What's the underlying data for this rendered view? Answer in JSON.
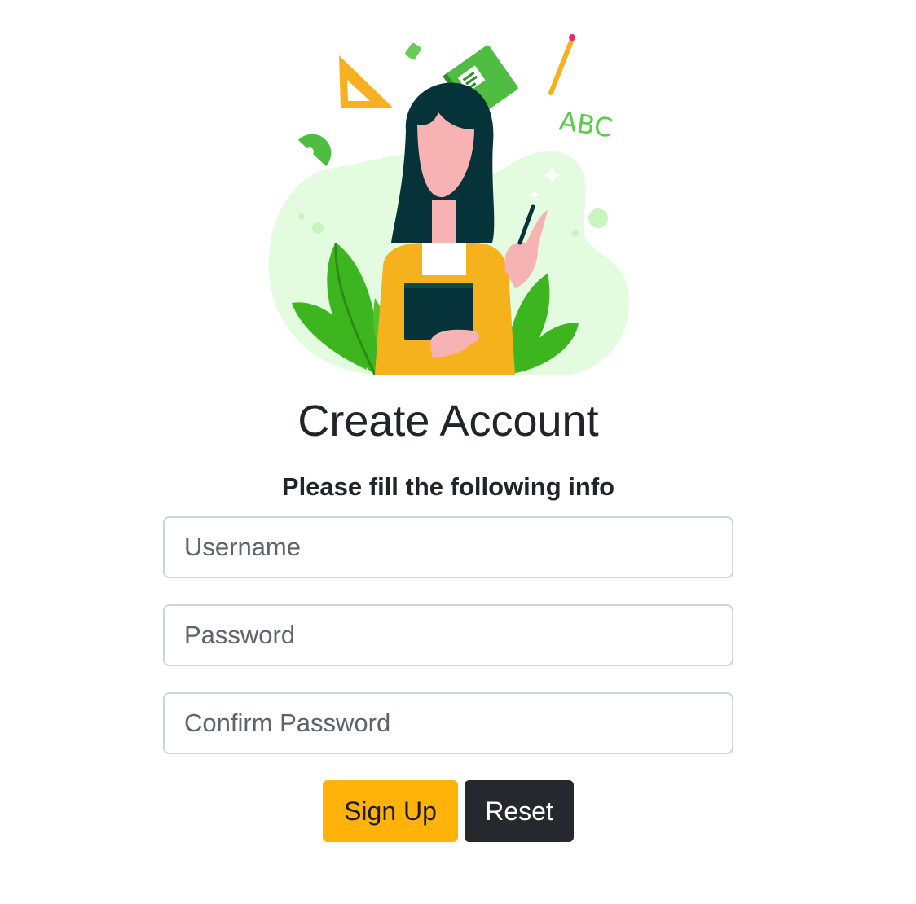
{
  "form": {
    "title": "Create Account",
    "subtitle": "Please fill the following info",
    "username": {
      "placeholder": "Username",
      "value": ""
    },
    "password": {
      "placeholder": "Password",
      "value": ""
    },
    "confirm_password": {
      "placeholder": "Confirm Password",
      "value": ""
    },
    "signup_label": "Sign Up",
    "reset_label": "Reset"
  },
  "illustration": {
    "name": "teacher-illustration",
    "abc_text": "ABC"
  },
  "colors": {
    "accent": "#ffb20a",
    "dark_button": "#25292d",
    "leaf_green": "#3db51f",
    "soft_green": "#e3fbdf",
    "hair": "#06323a"
  }
}
